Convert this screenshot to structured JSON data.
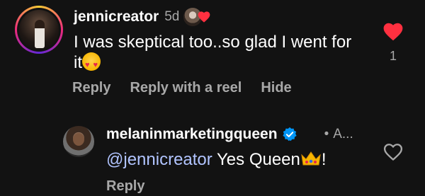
{
  "comment": {
    "username": "jennicreator",
    "time": "5d",
    "text": "I was skeptical too..so glad I went for it",
    "like_count": "1",
    "actions": {
      "reply": "Reply",
      "reply_reel": "Reply with a reel",
      "hide": "Hide"
    },
    "emoji_icon": "heart-eyes-emoji",
    "heart_color": "#ff3040"
  },
  "reply": {
    "username": "melaninmarketingqueen",
    "time_dot": "•",
    "time": "A...",
    "mention": "@jennicreator",
    "text": " Yes Queen",
    "trailing": "!",
    "emoji_icon": "crown-emoji",
    "actions": {
      "reply": "Reply"
    },
    "verified_icon": "verified-badge-icon"
  },
  "colors": {
    "background": "#121212",
    "like_red": "#ff3040",
    "mention_blue": "#b1c4ff",
    "verified_blue": "#0095f6"
  }
}
